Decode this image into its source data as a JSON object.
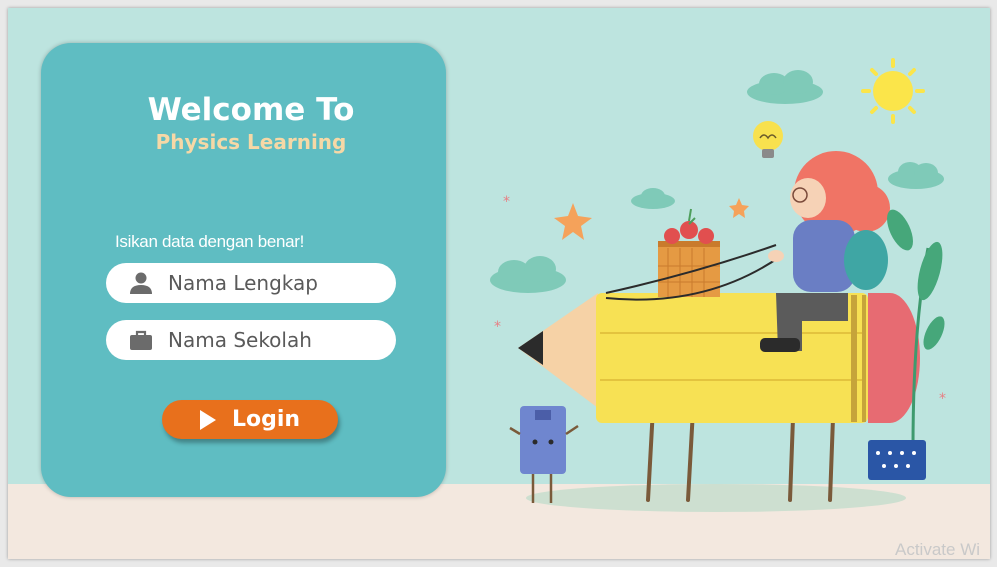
{
  "panel": {
    "title": "Welcome To",
    "subtitle": "Physics Learning",
    "instruction": "Isikan data dengan benar!",
    "fields": [
      {
        "placeholder": "Nama Lengkap",
        "icon": "user-icon"
      },
      {
        "placeholder": "Nama Sekolah",
        "icon": "briefcase-icon"
      }
    ],
    "login_label": "Login"
  },
  "watermark": "Activate Wi",
  "colors": {
    "background": "#bde4df",
    "panel": "#5fbdc2",
    "subtitle": "#f6d8a6",
    "login_button": "#e8701c"
  }
}
